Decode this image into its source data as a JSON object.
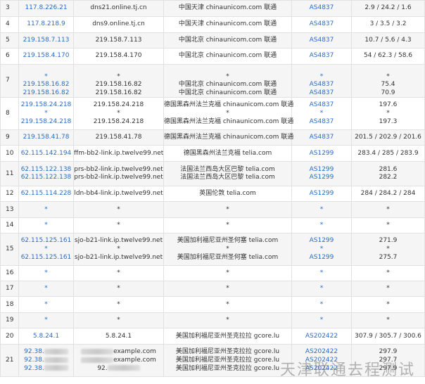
{
  "rows": [
    {
      "hop": "3",
      "ip": [
        "117.8.226.21"
      ],
      "host": [
        "dns21.online.tj.cn"
      ],
      "loc": [
        "中国天津 chinaunicom.com 联通"
      ],
      "asn": [
        "AS4837"
      ],
      "lat": [
        "2.9 / 24.2 / 1.6"
      ]
    },
    {
      "hop": "4",
      "ip": [
        "117.8.218.9"
      ],
      "host": [
        "dns9.online.tj.cn"
      ],
      "loc": [
        "中国天津 chinaunicom.com 联通"
      ],
      "asn": [
        "AS4837"
      ],
      "lat": [
        "3 / 3.5 / 3.2"
      ]
    },
    {
      "hop": "5",
      "ip": [
        "219.158.7.113"
      ],
      "host": [
        "219.158.7.113"
      ],
      "loc": [
        "中国北京 chinaunicom.com 联通"
      ],
      "asn": [
        "AS4837"
      ],
      "lat": [
        "10.7 / 5.6 / 4.3"
      ]
    },
    {
      "hop": "6",
      "ip": [
        "219.158.4.170"
      ],
      "host": [
        "219.158.4.170"
      ],
      "loc": [
        "中国北京 chinaunicom.com 联通"
      ],
      "asn": [
        "AS4837"
      ],
      "lat": [
        "54 / 62.3 / 58.6"
      ]
    },
    {
      "hop": "7",
      "ip": [
        "",
        "*",
        "219.158.16.82",
        "219.158.16.82"
      ],
      "host": [
        "",
        "*",
        "219.158.16.82",
        "219.158.16.82"
      ],
      "loc": [
        "",
        "*",
        "中国北京 chinaunicom.com 联通",
        "中国北京 chinaunicom.com 联通"
      ],
      "asn": [
        "",
        "*",
        "AS4837",
        "AS4837"
      ],
      "lat": [
        "",
        "*",
        "75.4",
        "70.9"
      ]
    },
    {
      "hop": "8",
      "ip": [
        "219.158.24.218",
        "*",
        "219.158.24.218"
      ],
      "host": [
        "219.158.24.218",
        "*",
        "219.158.24.218"
      ],
      "loc": [
        "德国黑森州法兰克福 chinaunicom.com 联通",
        "*",
        "德国黑森州法兰克福 chinaunicom.com 联通"
      ],
      "asn": [
        "AS4837",
        "*",
        "AS4837"
      ],
      "lat": [
        "197.6",
        "*",
        "197.3"
      ]
    },
    {
      "hop": "9",
      "ip": [
        "219.158.41.78"
      ],
      "host": [
        "219.158.41.78"
      ],
      "loc": [
        "德国黑森州法兰克福 chinaunicom.com 联通"
      ],
      "asn": [
        "AS4837"
      ],
      "lat": [
        "201.5 / 202.9 / 201.6"
      ]
    },
    {
      "hop": "10",
      "ip": [
        "62.115.142.194"
      ],
      "host": [
        "ffm-bb2-link.ip.twelve99.net"
      ],
      "loc": [
        "德国黑森州法兰克福 telia.com"
      ],
      "asn": [
        "AS1299"
      ],
      "lat": [
        "283.4 / 285 / 283.9"
      ]
    },
    {
      "hop": "11",
      "ip": [
        "62.115.122.138",
        "62.115.122.138"
      ],
      "host": [
        "prs-bb2-link.ip.twelve99.net",
        "prs-bb2-link.ip.twelve99.net"
      ],
      "loc": [
        "法国法兰西岛大区巴黎 telia.com",
        "法国法兰西岛大区巴黎 telia.com"
      ],
      "asn": [
        "AS1299",
        "AS1299"
      ],
      "lat": [
        "281.6",
        "282.2"
      ]
    },
    {
      "hop": "12",
      "ip": [
        "62.115.114.228"
      ],
      "host": [
        "ldn-bb4-link.ip.twelve99.net"
      ],
      "loc": [
        "英国伦敦 telia.com"
      ],
      "asn": [
        "AS1299"
      ],
      "lat": [
        "284 / 284.2 / 284"
      ]
    },
    {
      "hop": "13",
      "ip": [
        "*"
      ],
      "host": [
        "*"
      ],
      "loc": [
        "*"
      ],
      "asn": [
        "*"
      ],
      "lat": [
        "*"
      ]
    },
    {
      "hop": "14",
      "ip": [
        "*"
      ],
      "host": [
        "*"
      ],
      "loc": [
        "*"
      ],
      "asn": [
        "*"
      ],
      "lat": [
        "*"
      ]
    },
    {
      "hop": "15",
      "ip": [
        "62.115.125.161",
        "*",
        "62.115.125.161"
      ],
      "host": [
        "sjo-b21-link.ip.twelve99.net",
        "*",
        "sjo-b21-link.ip.twelve99.net"
      ],
      "loc": [
        "美国加利福尼亚州圣何塞 telia.com",
        "*",
        "美国加利福尼亚州圣何塞 telia.com"
      ],
      "asn": [
        "AS1299",
        "*",
        "AS1299"
      ],
      "lat": [
        "271.9",
        "*",
        "275.7"
      ]
    },
    {
      "hop": "16",
      "ip": [
        "*"
      ],
      "host": [
        "*"
      ],
      "loc": [
        "*"
      ],
      "asn": [
        "*"
      ],
      "lat": [
        "*"
      ]
    },
    {
      "hop": "17",
      "ip": [
        "*"
      ],
      "host": [
        "*"
      ],
      "loc": [
        "*"
      ],
      "asn": [
        "*"
      ],
      "lat": [
        "*"
      ]
    },
    {
      "hop": "18",
      "ip": [
        "*"
      ],
      "host": [
        "*"
      ],
      "loc": [
        "*"
      ],
      "asn": [
        "*"
      ],
      "lat": [
        "*"
      ]
    },
    {
      "hop": "19",
      "ip": [
        "*"
      ],
      "host": [
        "*"
      ],
      "loc": [
        "*"
      ],
      "asn": [
        "*"
      ],
      "lat": [
        "*"
      ]
    },
    {
      "hop": "20",
      "ip": [
        "5.8.24.1"
      ],
      "host": [
        "5.8.24.1"
      ],
      "loc": [
        "美国加利福尼亚州圣克拉拉 gcore.lu"
      ],
      "asn": [
        "AS202422"
      ],
      "lat": [
        "307.9 / 305.7 / 300.6"
      ]
    },
    {
      "hop": "21",
      "ip": [
        "92.38.",
        "92.38.",
        "92.38."
      ],
      "host": [
        "example.com",
        "example.com",
        "92."
      ],
      "loc": [
        "美国加利福尼亚州圣克拉拉 gcore.lu",
        "美国加利福尼亚州圣克拉拉 gcore.lu",
        "美国加利福尼亚州圣克拉拉 gcore.lu"
      ],
      "asn": [
        "AS202422",
        "AS202422",
        "AS202422"
      ],
      "lat": [
        "297.9",
        "297.7",
        "297.9"
      ]
    }
  ],
  "watermark": "天津联通去程测试",
  "colors": {
    "link": "#2a6cc7",
    "text": "#333333",
    "stripe": "#f5f5f5",
    "border": "#e1e1e1"
  }
}
